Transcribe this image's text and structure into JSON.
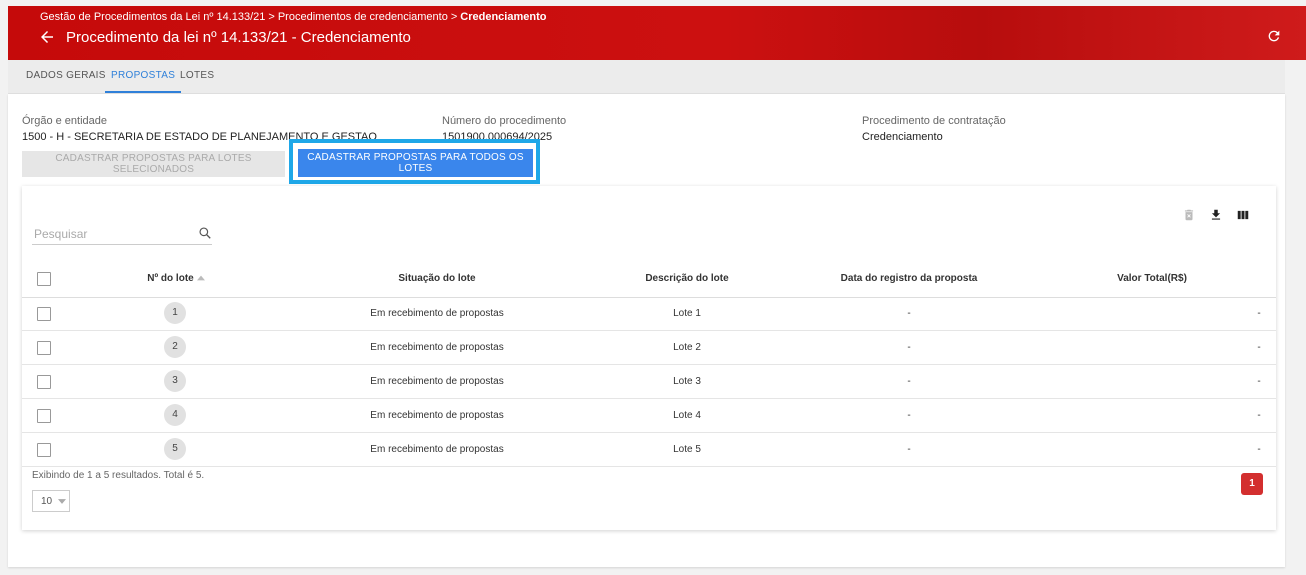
{
  "header": {
    "breadcrumb": [
      "Gestão de Procedimentos da Lei nº 14.133/21",
      "Procedimentos de credenciamento",
      "Credenciamento"
    ],
    "breadcrumb_separator": ">",
    "title": "Procedimento da lei nº 14.133/21 - Credenciamento",
    "color": "#c50a0a"
  },
  "tabs": [
    {
      "label": "DADOS GERAIS"
    },
    {
      "label": "PROPOSTAS"
    },
    {
      "label": "LOTES"
    }
  ],
  "active_tab": "PROPOSTAS",
  "info": {
    "orgao_label": "Órgão e entidade",
    "orgao_value": "1500 - H - SECRETARIA DE ESTADO DE PLANEJAMENTO E GESTAO",
    "numero_label": "Número do procedimento",
    "numero_value": "1501900.000694/2025",
    "procedimento_label": "Procedimento de contratação",
    "procedimento_value": "Credenciamento"
  },
  "actions": {
    "selected_label": "CADASTRAR PROPOSTAS PARA LOTES SELECIONADOS",
    "all_label": "CADASTRAR PROPOSTAS PARA TODOS OS LOTES",
    "primary_color": "#3a86ec",
    "highlight_color": "#1ea7e8"
  },
  "search": {
    "placeholder": "Pesquisar"
  },
  "table": {
    "columns": [
      "Nº do lote",
      "Situação do lote",
      "Descrição do lote",
      "Data do registro da proposta",
      "Valor Total(R$)"
    ],
    "rows": [
      {
        "lote": "1",
        "situacao": "Em recebimento de propostas",
        "descricao": "Lote 1",
        "data": "-",
        "valor": "-"
      },
      {
        "lote": "2",
        "situacao": "Em recebimento de propostas",
        "descricao": "Lote 2",
        "data": "-",
        "valor": "-"
      },
      {
        "lote": "3",
        "situacao": "Em recebimento de propostas",
        "descricao": "Lote 3",
        "data": "-",
        "valor": "-"
      },
      {
        "lote": "4",
        "situacao": "Em recebimento de propostas",
        "descricao": "Lote 4",
        "data": "-",
        "valor": "-"
      },
      {
        "lote": "5",
        "situacao": "Em recebimento de propostas",
        "descricao": "Lote 5",
        "data": "-",
        "valor": "-"
      }
    ]
  },
  "pagination": {
    "summary": "Exibindo de 1 a 5 resultados. Total é 5.",
    "page_size": "10",
    "current_page": "1",
    "color": "#d32f2f"
  },
  "icons": [
    "back-arrow-icon",
    "refresh-icon",
    "search-icon",
    "delete-icon",
    "download-icon",
    "columns-icon",
    "sort-up-icon",
    "dropdown-icon"
  ]
}
